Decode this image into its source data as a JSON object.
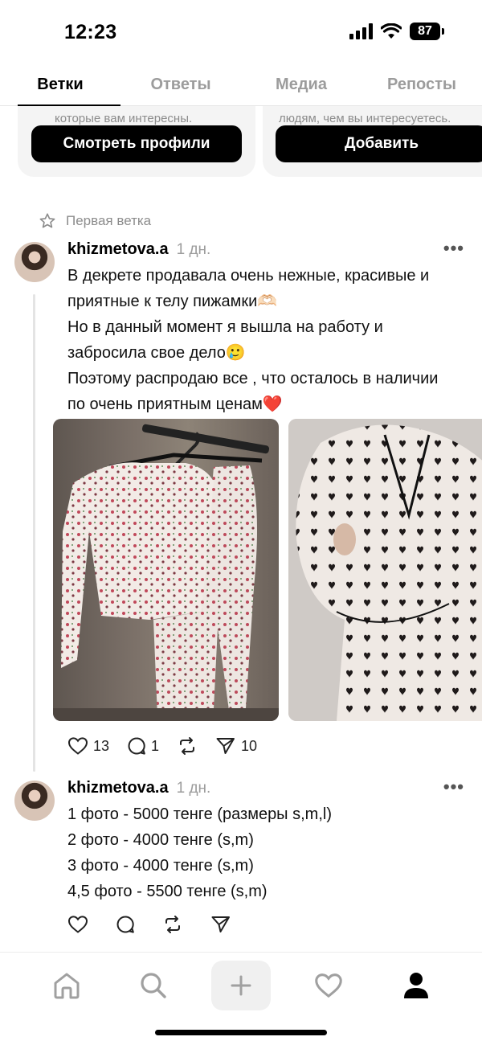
{
  "status_bar": {
    "time": "12:23",
    "battery": "87"
  },
  "tabs": [
    {
      "label": "Ветки"
    },
    {
      "label": "Ответы"
    },
    {
      "label": "Медиа"
    },
    {
      "label": "Репосты"
    }
  ],
  "suggestion_cards": [
    {
      "partial_text": "которые вам интересны.",
      "button": "Смотреть профили"
    },
    {
      "partial_text": "людям, чем вы интересуетесь.",
      "button": "Добавить"
    }
  ],
  "pinned": {
    "label": "Первая ветка"
  },
  "posts": [
    {
      "username": "khizmetova.a",
      "time": "1 дн.",
      "lines": [
        "В декрете продавала очень нежные, красивые и",
        "приятные к телу пижамки🫶🏻",
        "Но в данный момент я вышла на работу и",
        "забросила свое дело🥲",
        "Поэтому распродаю все , что осталось в наличии",
        "по очень приятным ценам❤️"
      ],
      "stats": {
        "likes": "13",
        "replies": "1",
        "shares": "10"
      }
    },
    {
      "username": "khizmetova.a",
      "time": "1 дн.",
      "lines": [
        "1 фото - 5000 тенге (размеры s,m,l)",
        "2 фото - 4000 тенге (s,m)",
        "3 фото - 4000 тенге (s,m)",
        "4,5 фото - 5500 тенге (s,m)"
      ]
    }
  ],
  "colors": {
    "accent": "#000000",
    "muted": "#9c9c9c",
    "card_bg": "#f4f4f4"
  }
}
